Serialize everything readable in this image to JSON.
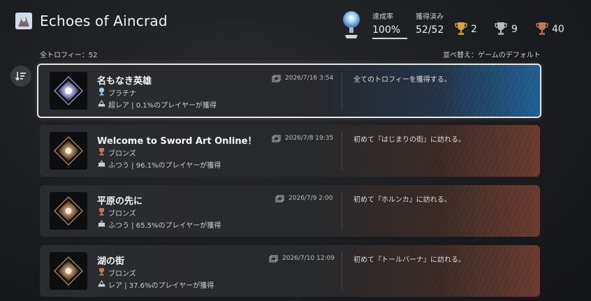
{
  "header": {
    "game_title": "Echoes of Aincrad",
    "completion_label": "達成率",
    "completion_value": "100%",
    "completion_progress": 1.0,
    "earned_label": "獲得済み",
    "earned_value": "52/52",
    "gold_count": "2",
    "silver_count": "9",
    "bronze_count": "40"
  },
  "list": {
    "total_label": "全トロフィー：52",
    "sort_label": "並べ替え：ゲームのデフォルト"
  },
  "trophies": [
    {
      "name": "名もなき英雄",
      "type": "プラチナ",
      "rarity": "超レア | 0.1%のプレイヤーが獲得",
      "date": "2026/7/16  3:54",
      "description": "全てのトロフィーを獲得する。"
    },
    {
      "name": "Welcome to Sword Art Online！",
      "type": "ブロンズ",
      "rarity": "ふつう | 96.1%のプレイヤーが獲得",
      "date": "2026/7/8  19:35",
      "description": "初めて『はじまりの街』に訪れる。"
    },
    {
      "name": "平原の先に",
      "type": "ブロンズ",
      "rarity": "ふつう | 65.5%のプレイヤーが獲得",
      "date": "2026/7/9  2:00",
      "description": "初めて『ホルンカ』に訪れる。"
    },
    {
      "name": "湖の街",
      "type": "ブロンズ",
      "rarity": "レア | 37.6%のプレイヤーが獲得",
      "date": "2026/7/10  12:09",
      "description": "初めて『トールバーナ』に訪れる。"
    }
  ],
  "colors": {
    "gold": "#d9a43a",
    "silver": "#b8bcc2",
    "bronze": "#c0785a",
    "platinum": "#9ec8ef",
    "selected_accent": "#1f5f93"
  }
}
